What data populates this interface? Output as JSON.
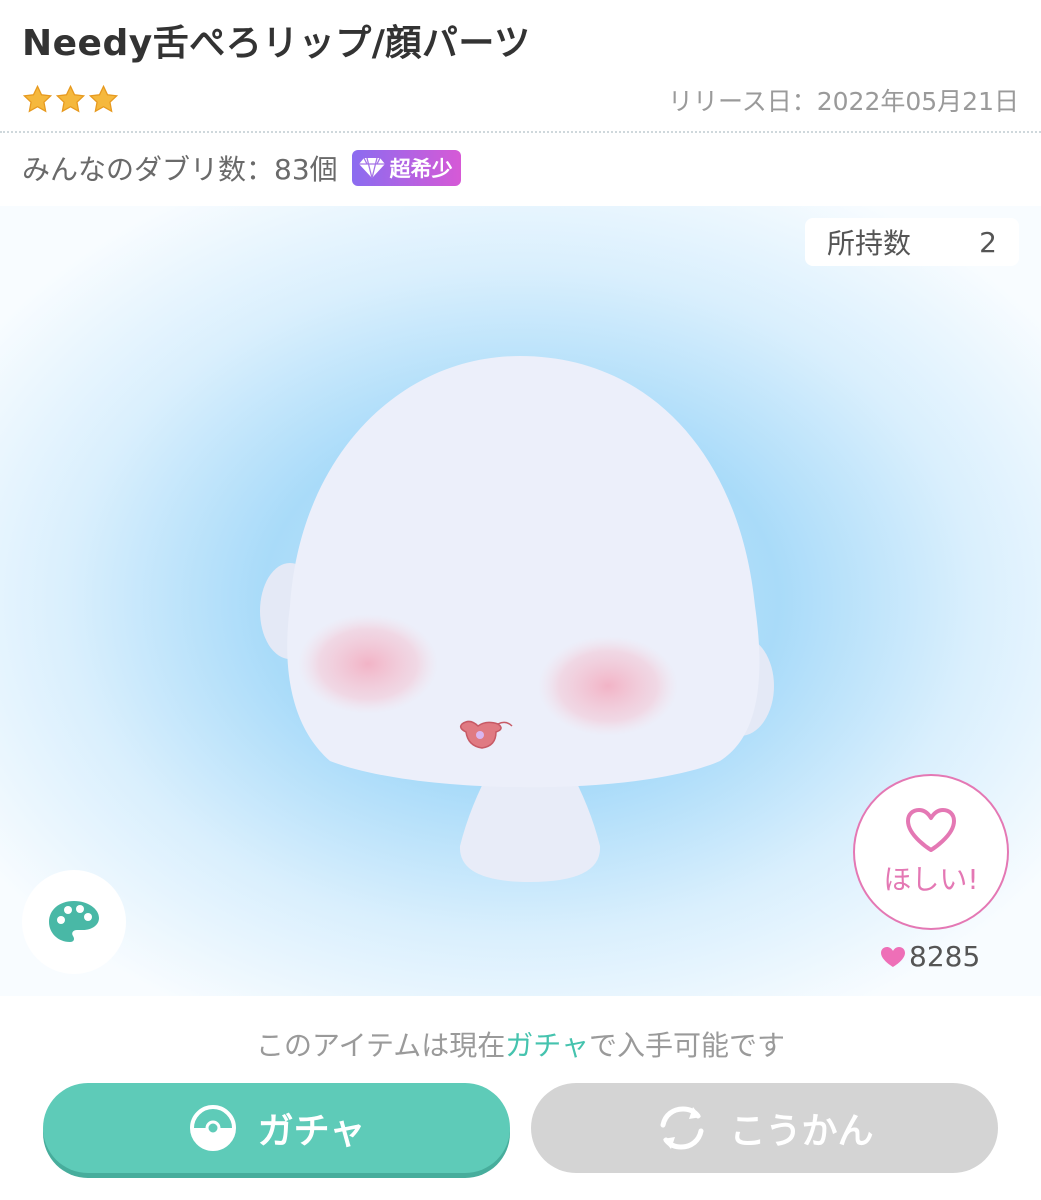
{
  "item": {
    "title": "Needy舌ぺろリップ/顔パーツ",
    "stars": 3,
    "release_label": "リリース日：",
    "release_date": "2022年05月21日",
    "dupes_label": "みんなのダブリ数：",
    "dupes_value": "83個",
    "rarity_badge": "超希少"
  },
  "owned": {
    "label": "所持数",
    "value": "2"
  },
  "want": {
    "label": "ほしい!",
    "count": "8285"
  },
  "availability": {
    "before": "このアイテムは現在",
    "highlight": "ガチャ",
    "after": "で入手可能です"
  },
  "buttons": {
    "gacha": "ガチャ",
    "exchange": "こうかん"
  },
  "colors": {
    "accent_green": "#5ecbb8",
    "pink": "#e478b4",
    "star_gold": "#f5b83d",
    "badge_gradient_start": "#8b6cf0",
    "badge_gradient_end": "#d659d6",
    "disabled_gray": "#d4d4d4"
  }
}
